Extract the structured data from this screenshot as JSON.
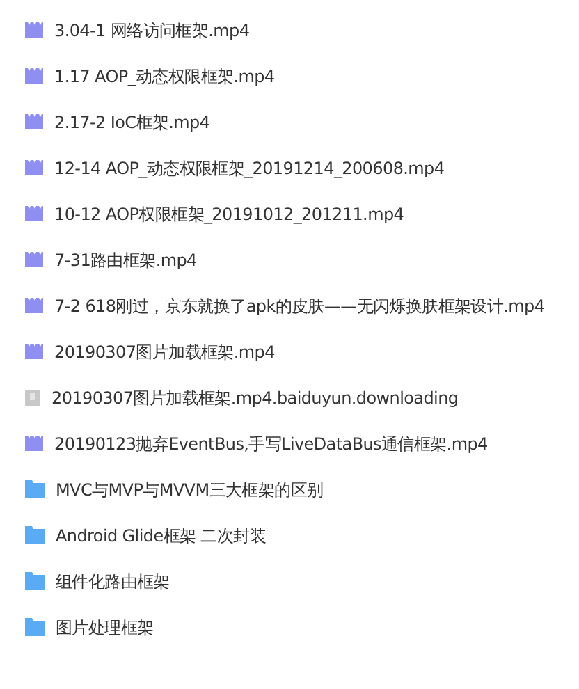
{
  "files": [
    {
      "kind": "video",
      "name": "3.04-1 网络访问框架.mp4"
    },
    {
      "kind": "video",
      "name": "1.17 AOP_动态权限框架.mp4"
    },
    {
      "kind": "video",
      "name": "2.17-2 IoC框架.mp4"
    },
    {
      "kind": "video",
      "name": "12-14 AOP_动态权限框架_20191214_200608.mp4"
    },
    {
      "kind": "video",
      "name": "10-12 AOP权限框架_20191012_201211.mp4"
    },
    {
      "kind": "video",
      "name": "7-31路由框架.mp4"
    },
    {
      "kind": "video",
      "name": "7-2 618刚过，京东就换了apk的皮肤——无闪烁换肤框架设计.mp4"
    },
    {
      "kind": "video",
      "name": "20190307图片加载框架.mp4"
    },
    {
      "kind": "unknown",
      "name": "20190307图片加载框架.mp4.baiduyun.downloading"
    },
    {
      "kind": "video",
      "name": "20190123抛弃EventBus,手写LiveDataBus通信框架.mp4"
    },
    {
      "kind": "folder",
      "name": "MVC与MVP与MVVM三大框架的区别"
    },
    {
      "kind": "folder",
      "name": "Android Glide框架 二次封装"
    },
    {
      "kind": "folder",
      "name": "组件化路由框架"
    },
    {
      "kind": "folder",
      "name": "图片处理框架"
    }
  ]
}
